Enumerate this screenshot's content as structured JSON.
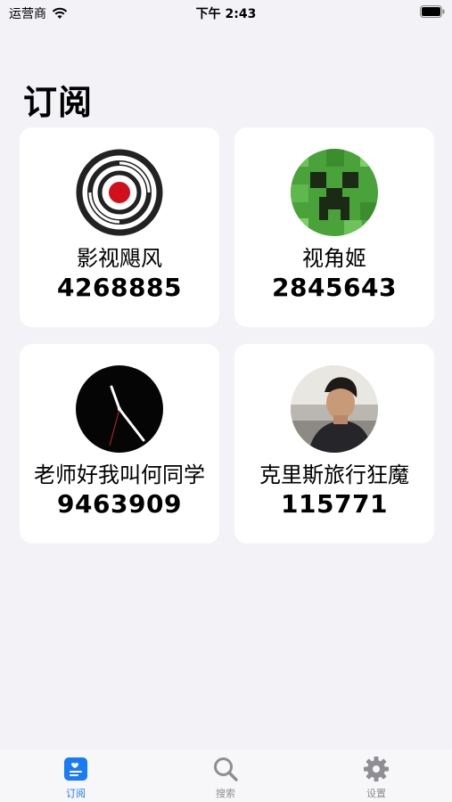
{
  "status_bar": {
    "carrier": "运营商",
    "time": "下午 2:43"
  },
  "page": {
    "title": "订阅"
  },
  "subscriptions": [
    {
      "name": "影视飓风",
      "count": "4268885",
      "avatar_icon": "red-aperture-logo"
    },
    {
      "name": "视角姬",
      "count": "2845643",
      "avatar_icon": "pixel-creeper-face"
    },
    {
      "name": "老师好我叫何同学",
      "count": "9463909",
      "avatar_icon": "clock-face"
    },
    {
      "name": "克里斯旅行狂魔",
      "count": "115771",
      "avatar_icon": "person-photo"
    }
  ],
  "tabs": [
    {
      "label": "订阅",
      "icon": "subscription-icon",
      "active": true
    },
    {
      "label": "搜索",
      "icon": "search-icon",
      "active": false
    },
    {
      "label": "设置",
      "icon": "gear-icon",
      "active": false
    }
  ],
  "colors": {
    "accent": "#1a7cf5",
    "inactive_tab": "#8e8e93",
    "background": "#f2f2f7",
    "card": "#ffffff"
  }
}
